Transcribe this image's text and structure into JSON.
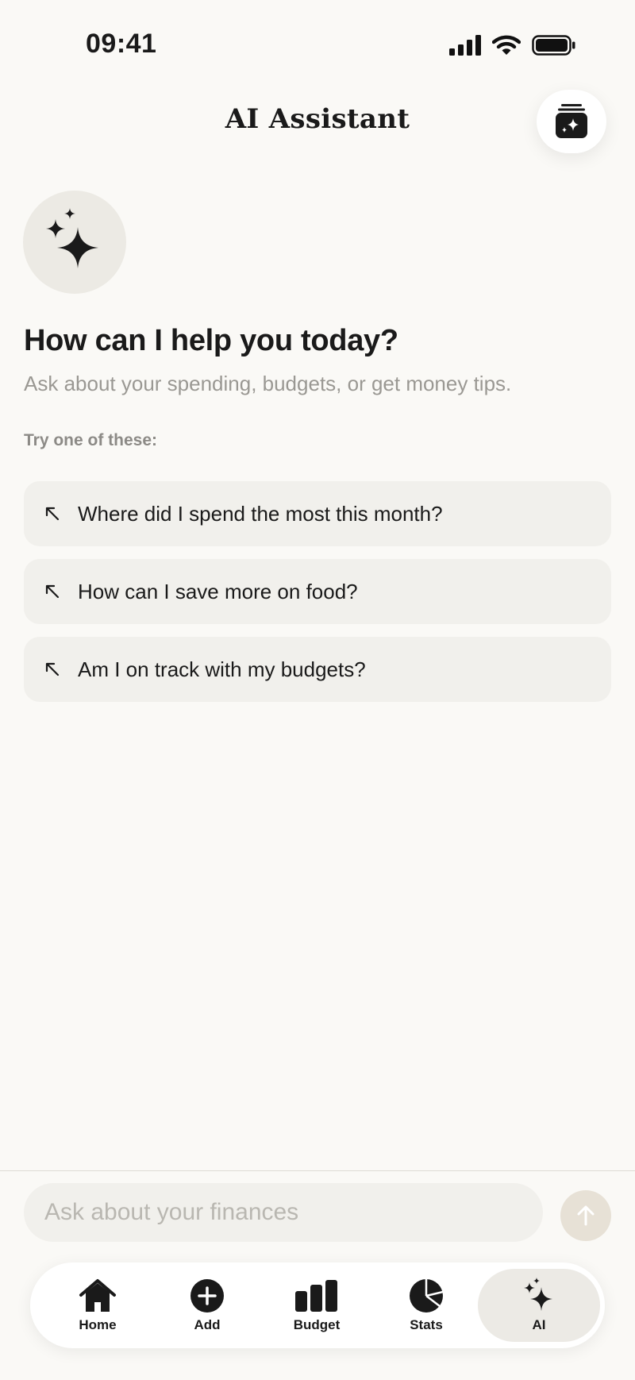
{
  "status_bar": {
    "time": "09:41"
  },
  "header": {
    "title": "AI Assistant"
  },
  "hero": {
    "title": "How can I help you today?",
    "subtitle": "Ask about your spending, budgets, or get money tips."
  },
  "suggestions": {
    "label": "Try one of these:",
    "items": [
      "Where did I spend the most this month?",
      "How can I save more on food?",
      "Am I on track with my budgets?"
    ]
  },
  "chat": {
    "placeholder": "Ask about your finances"
  },
  "tabs": [
    {
      "label": "Home",
      "icon": "home-icon"
    },
    {
      "label": "Add",
      "icon": "plus-circle-icon"
    },
    {
      "label": "Budget",
      "icon": "bar-chart-icon"
    },
    {
      "label": "Stats",
      "icon": "pie-chart-icon"
    },
    {
      "label": "AI",
      "icon": "sparkles-icon",
      "active": true
    }
  ],
  "colors": {
    "background": "#FAF9F6",
    "card": "#F1F0EC",
    "text": "#1A1A1A",
    "muted": "#9A9893",
    "send_disabled": "#E7E1D6"
  }
}
